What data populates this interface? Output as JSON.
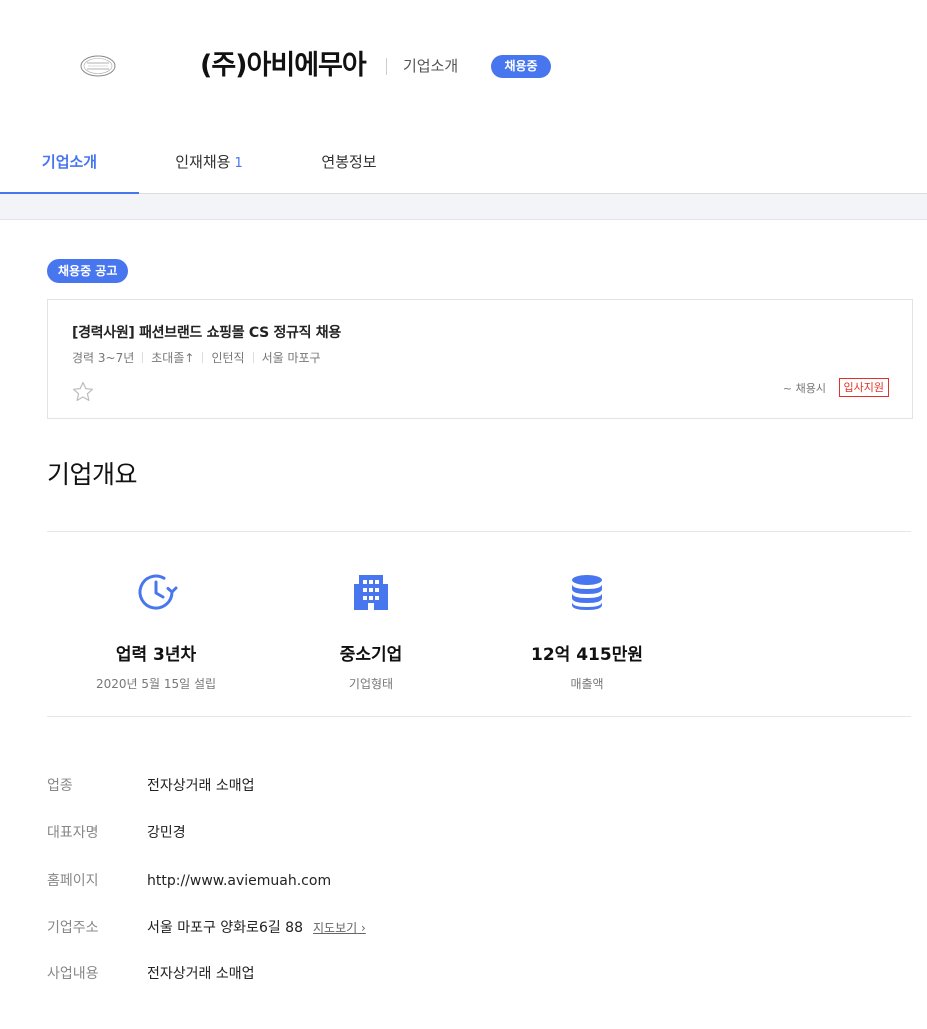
{
  "header": {
    "company_name": "(주)아비에무아",
    "subtitle": "기업소개",
    "badge": "채용중"
  },
  "tabs": [
    {
      "label": "기업소개",
      "active": true
    },
    {
      "label": "인재채용",
      "count": "1"
    },
    {
      "label": "연봉정보"
    }
  ],
  "postings": {
    "badge": "채용중 공고",
    "job": {
      "title": "[경력사원] 패션브랜드 쇼핑몰 CS 정규직 채용",
      "meta": [
        "경력 3~7년",
        "초대졸↑",
        "인턴직",
        "서울 마포구"
      ],
      "deadline": "~ 채용시",
      "apply_label": "입사지원"
    }
  },
  "overview": {
    "title": "기업개요",
    "stats": [
      {
        "icon": "history-clock-icon",
        "value": "업력 3년차",
        "label": "2020년 5월 15일 설립"
      },
      {
        "icon": "building-icon",
        "value": "중소기업",
        "label": "기업형태"
      },
      {
        "icon": "coins-icon",
        "value": "12억 415만원",
        "label": "매출액"
      }
    ],
    "accent_color": "#4876ef"
  },
  "info": [
    {
      "label": "업종",
      "value": "전자상거래 소매업"
    },
    {
      "label": "대표자명",
      "value": "강민경"
    },
    {
      "label": "홈페이지",
      "value": "http://www.aviemuah.com"
    },
    {
      "label": "기업주소",
      "value": "서울 마포구 양화로6길 88",
      "link": "지도보기"
    },
    {
      "label": "사업내용",
      "value": "전자상거래 소매업"
    }
  ]
}
